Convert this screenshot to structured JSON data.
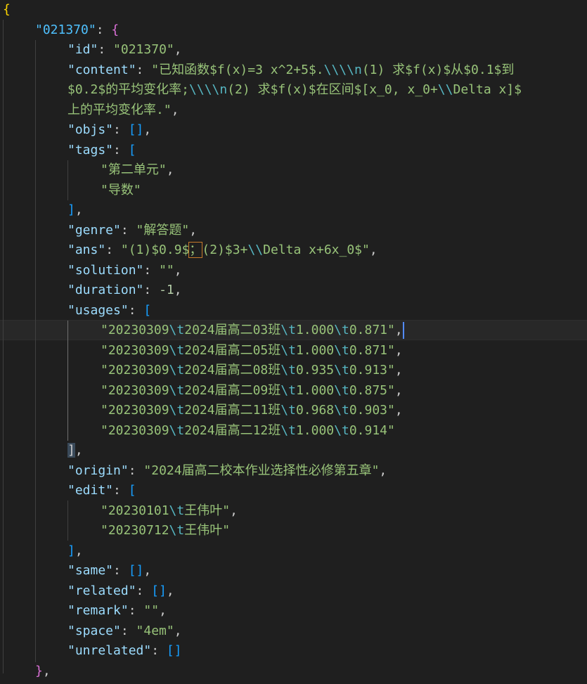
{
  "lines": [
    {
      "parts": [
        [
          "b1",
          "{"
        ]
      ]
    },
    {
      "parts": [
        [
          "ks",
          "\"021370\""
        ],
        [
          "p",
          ": "
        ],
        [
          "b2",
          "{"
        ]
      ]
    },
    {
      "parts": [
        [
          "k",
          "\"id\""
        ],
        [
          "p",
          ": "
        ],
        [
          "s2",
          "\"021370\""
        ],
        [
          "p",
          ","
        ]
      ]
    },
    {
      "parts": [
        [
          "k",
          "\"content\""
        ],
        [
          "p",
          ": "
        ],
        [
          "s2",
          "\"已知函数$f(x)=3 x^2+5$."
        ],
        [
          "esc2",
          "\\\\\\\\n"
        ],
        [
          "s2",
          "(1) 求$f(x)$从$0.1$到"
        ]
      ]
    },
    {
      "parts": [
        [
          "s2",
          "$0.2$的平均变化率;"
        ],
        [
          "esc2",
          "\\\\\\\\n"
        ],
        [
          "s2",
          "(2) 求$f(x)$在区间$[x_0, x_0+"
        ],
        [
          "esc2",
          "\\\\"
        ],
        [
          "s2",
          "Delta x]$"
        ]
      ]
    },
    {
      "parts": [
        [
          "s2",
          "上的平均变化率.\""
        ],
        [
          "p",
          ","
        ]
      ]
    },
    {
      "parts": [
        [
          "k",
          "\"objs\""
        ],
        [
          "p",
          ": "
        ],
        [
          "b3",
          "[]"
        ],
        [
          "p",
          ","
        ]
      ]
    },
    {
      "parts": [
        [
          "k",
          "\"tags\""
        ],
        [
          "p",
          ": "
        ],
        [
          "b3",
          "["
        ]
      ]
    },
    {
      "parts": [
        [
          "s2",
          "\"第二单元\""
        ],
        [
          "p",
          ","
        ]
      ]
    },
    {
      "parts": [
        [
          "s2",
          "\"导数\""
        ]
      ]
    },
    {
      "parts": [
        [
          "b3",
          "]"
        ],
        [
          "p",
          ","
        ]
      ]
    },
    {
      "parts": [
        [
          "k",
          "\"genre\""
        ],
        [
          "p",
          ": "
        ],
        [
          "s2",
          "\"解答题\""
        ],
        [
          "p",
          ","
        ]
      ]
    },
    {
      "parts": [
        [
          "k",
          "\"ans\""
        ],
        [
          "p",
          ": "
        ],
        [
          "s2",
          "\"(1)$0.9$"
        ],
        [
          "sel",
          "；"
        ],
        [
          "s2",
          "(2)$3+"
        ],
        [
          "esc2",
          "\\\\"
        ],
        [
          "s2",
          "Delta x+6x_0$\""
        ],
        [
          "p",
          ","
        ]
      ]
    },
    {
      "parts": [
        [
          "k",
          "\"solution\""
        ],
        [
          "p",
          ": "
        ],
        [
          "s2",
          "\"\""
        ],
        [
          "p",
          ","
        ]
      ]
    },
    {
      "parts": [
        [
          "k",
          "\"duration\""
        ],
        [
          "p",
          ": "
        ],
        [
          "n",
          "-1"
        ],
        [
          "p",
          ","
        ]
      ]
    },
    {
      "parts": [
        [
          "k",
          "\"usages\""
        ],
        [
          "p",
          ": "
        ],
        [
          "b3",
          "["
        ]
      ]
    },
    {
      "parts": [
        [
          "s2",
          "\"20230309"
        ],
        [
          "esc2",
          "\\t"
        ],
        [
          "s2",
          "2024届高二03班"
        ],
        [
          "esc2",
          "\\t"
        ],
        [
          "s2",
          "1.000"
        ],
        [
          "esc2",
          "\\t"
        ],
        [
          "s2",
          "0.871\""
        ],
        [
          "p",
          ","
        ]
      ]
    },
    {
      "parts": [
        [
          "s2",
          "\"20230309"
        ],
        [
          "esc2",
          "\\t"
        ],
        [
          "s2",
          "2024届高二05班"
        ],
        [
          "esc2",
          "\\t"
        ],
        [
          "s2",
          "1.000"
        ],
        [
          "esc2",
          "\\t"
        ],
        [
          "s2",
          "0.871\""
        ],
        [
          "p",
          ","
        ]
      ]
    },
    {
      "parts": [
        [
          "s2",
          "\"20230309"
        ],
        [
          "esc2",
          "\\t"
        ],
        [
          "s2",
          "2024届高二08班"
        ],
        [
          "esc2",
          "\\t"
        ],
        [
          "s2",
          "0.935"
        ],
        [
          "esc2",
          "\\t"
        ],
        [
          "s2",
          "0.913\""
        ],
        [
          "p",
          ","
        ]
      ]
    },
    {
      "parts": [
        [
          "s2",
          "\"20230309"
        ],
        [
          "esc2",
          "\\t"
        ],
        [
          "s2",
          "2024届高二09班"
        ],
        [
          "esc2",
          "\\t"
        ],
        [
          "s2",
          "1.000"
        ],
        [
          "esc2",
          "\\t"
        ],
        [
          "s2",
          "0.875\""
        ],
        [
          "p",
          ","
        ]
      ]
    },
    {
      "parts": [
        [
          "s2",
          "\"20230309"
        ],
        [
          "esc2",
          "\\t"
        ],
        [
          "s2",
          "2024届高二11班"
        ],
        [
          "esc2",
          "\\t"
        ],
        [
          "s2",
          "0.968"
        ],
        [
          "esc2",
          "\\t"
        ],
        [
          "s2",
          "0.903\""
        ],
        [
          "p",
          ","
        ]
      ]
    },
    {
      "parts": [
        [
          "s2",
          "\"20230309"
        ],
        [
          "esc2",
          "\\t"
        ],
        [
          "s2",
          "2024届高二12班"
        ],
        [
          "esc2",
          "\\t"
        ],
        [
          "s2",
          "1.000"
        ],
        [
          "esc2",
          "\\t"
        ],
        [
          "s2",
          "0.914\""
        ]
      ]
    },
    {
      "parts": [
        [
          "brk",
          "]"
        ],
        [
          "p",
          ","
        ]
      ]
    },
    {
      "parts": [
        [
          "k",
          "\"origin\""
        ],
        [
          "p",
          ": "
        ],
        [
          "s2",
          "\"2024届高二校本作业选择性必修第五章\""
        ],
        [
          "p",
          ","
        ]
      ]
    },
    {
      "parts": [
        [
          "k",
          "\"edit\""
        ],
        [
          "p",
          ": "
        ],
        [
          "b3",
          "["
        ]
      ]
    },
    {
      "parts": [
        [
          "s2",
          "\"20230101"
        ],
        [
          "esc2",
          "\\t"
        ],
        [
          "s2",
          "王伟叶\""
        ],
        [
          "p",
          ","
        ]
      ]
    },
    {
      "parts": [
        [
          "s2",
          "\"20230712"
        ],
        [
          "esc2",
          "\\t"
        ],
        [
          "s2",
          "王伟叶\""
        ]
      ]
    },
    {
      "parts": [
        [
          "b3",
          "]"
        ],
        [
          "p",
          ","
        ]
      ]
    },
    {
      "parts": [
        [
          "k",
          "\"same\""
        ],
        [
          "p",
          ": "
        ],
        [
          "b3",
          "[]"
        ],
        [
          "p",
          ","
        ]
      ]
    },
    {
      "parts": [
        [
          "k",
          "\"related\""
        ],
        [
          "p",
          ": "
        ],
        [
          "b3",
          "[]"
        ],
        [
          "p",
          ","
        ]
      ]
    },
    {
      "parts": [
        [
          "k",
          "\"remark\""
        ],
        [
          "p",
          ": "
        ],
        [
          "s2",
          "\"\""
        ],
        [
          "p",
          ","
        ]
      ]
    },
    {
      "parts": [
        [
          "k",
          "\"space\""
        ],
        [
          "p",
          ": "
        ],
        [
          "s2",
          "\"4em\""
        ],
        [
          "p",
          ","
        ]
      ]
    },
    {
      "parts": [
        [
          "k",
          "\"unrelated\""
        ],
        [
          "p",
          ": "
        ],
        [
          "b3",
          "[]"
        ]
      ]
    },
    {
      "parts": [
        [
          "b2",
          "}"
        ],
        [
          "p",
          ","
        ]
      ]
    }
  ]
}
